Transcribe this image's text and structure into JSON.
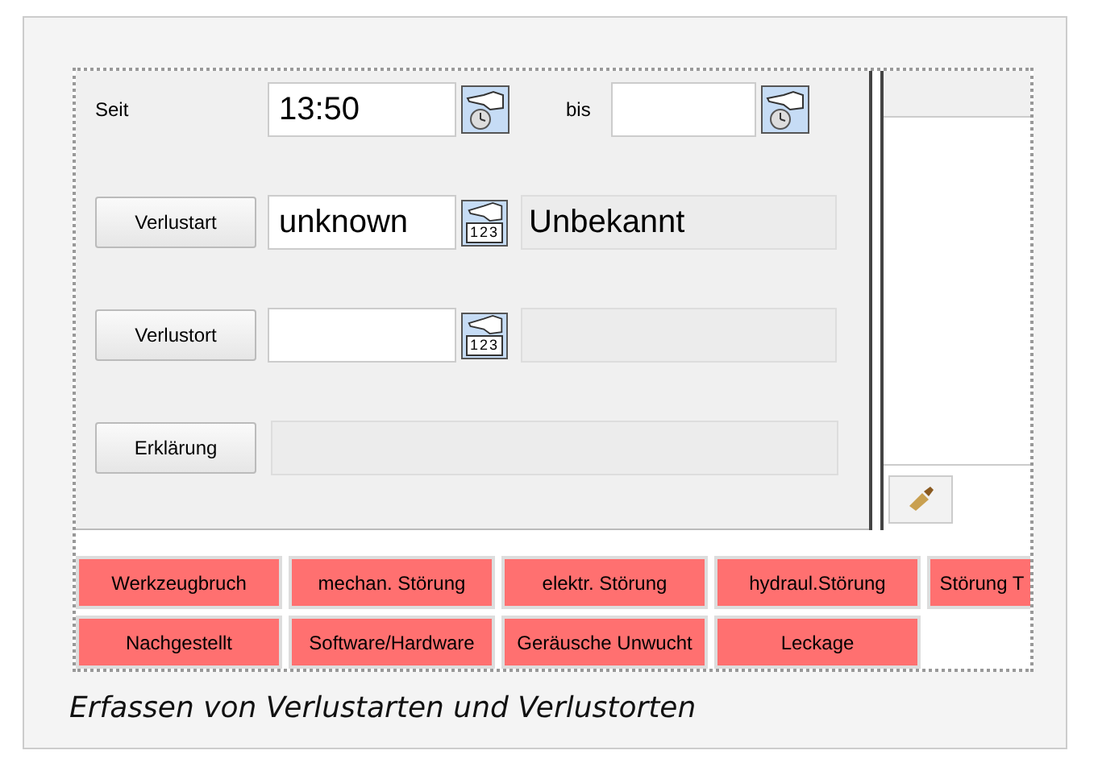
{
  "form": {
    "rows": [
      {
        "kind": "time",
        "label": "Seit",
        "value": "13:50",
        "to_label": "bis"
      },
      {
        "kind": "lookup",
        "label": "Verlustart",
        "value": "unknown",
        "icon_digits": "123",
        "description": "Unbekannt"
      },
      {
        "kind": "lookup",
        "label": "Verlustort",
        "icon_digits": "123"
      },
      {
        "kind": "text",
        "label": "Erklärung"
      }
    ]
  },
  "categories": [
    "Werkzeugbruch",
    "mechan. Störung",
    "elektr. Störung",
    "hydraul.Störung",
    "Störung T",
    "Nachgestellt",
    "Software/Hardware",
    "Geräusche Unwucht",
    "Leckage"
  ],
  "caption": "Erfassen von Verlustarten und Verlustorten"
}
